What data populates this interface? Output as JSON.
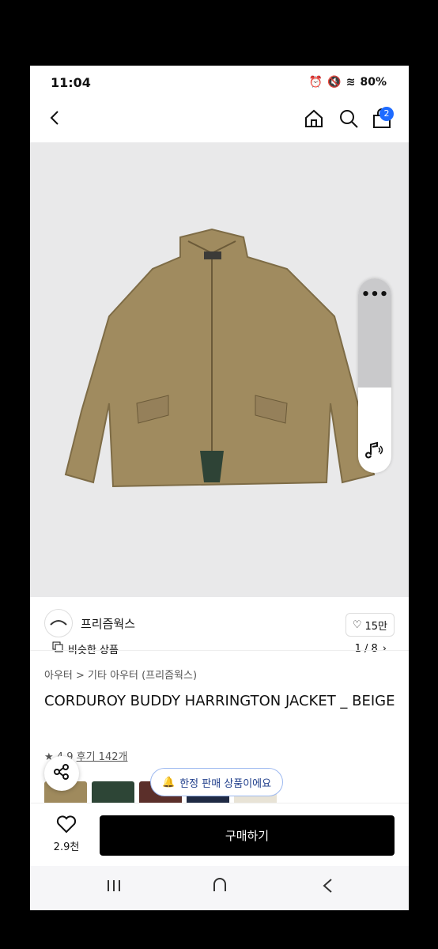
{
  "status": {
    "time": "11:04",
    "battery": "80%"
  },
  "header": {
    "cart_count": "2"
  },
  "gallery": {
    "similar_label": "비슷한 상품",
    "page_indicator": "1 / 8"
  },
  "brand": {
    "name": "프리즘웍스",
    "likes": "15만"
  },
  "product": {
    "breadcrumb": "아우터 > 기타 아우터 (프리즘웍스)",
    "title": "CORDUROY BUDDY HARRINGTON JACKET _ BEIGE",
    "rating": "4.9",
    "reviews": "후기 142개",
    "toast": "한정 판매 상품이에요"
  },
  "swatch_colors": [
    "#9f8a5d",
    "#2d4536",
    "#5b2f2a",
    "#1f2a44",
    "#e8e3d6"
  ],
  "bottom": {
    "heart_count": "2.9천",
    "buy_label": "구매하기"
  },
  "colors": {
    "accent": "#1e6bff",
    "buy": "#000000"
  }
}
